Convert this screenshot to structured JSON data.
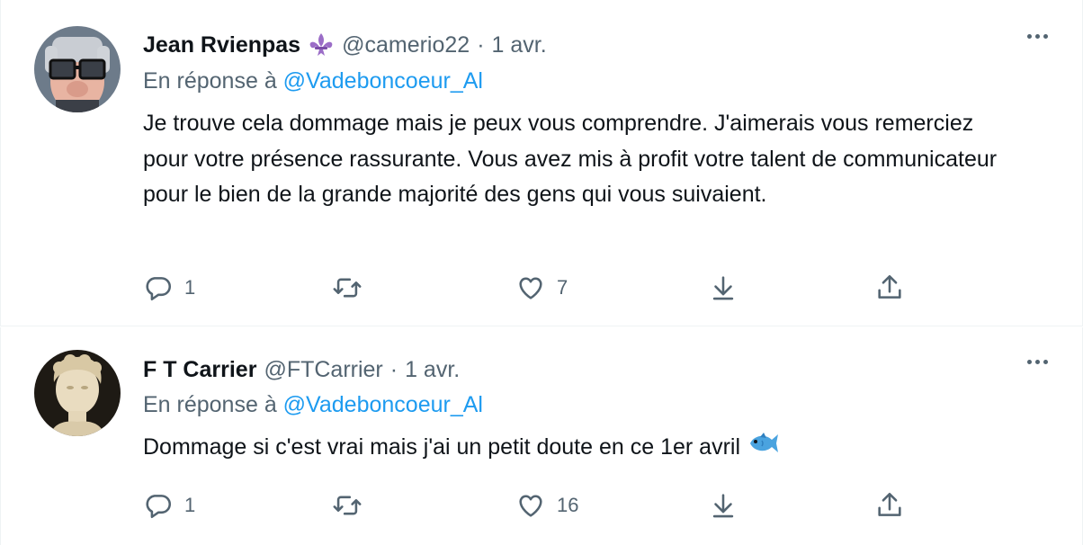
{
  "tweets": [
    {
      "name": "Jean Rvienpas",
      "name_emoji": "fleur-de-lis-icon",
      "handle": "@camerio22",
      "separator": "·",
      "date": "1 avr.",
      "reply_prefix": "En réponse à",
      "reply_mention": "@Vadeboncoeur_Al",
      "text": "Je trouve cela dommage mais je peux vous comprendre. J'aimerais vous remerciez pour votre présence rassurante.  Vous avez mis à profit votre talent de communicateur pour le bien de la grande majorité des gens qui vous suivaient.",
      "reply_count": "1",
      "retweet_count": "",
      "like_count": "7"
    },
    {
      "name": "F T Carrier",
      "handle": "@FTCarrier",
      "separator": "·",
      "date": "1 avr.",
      "reply_prefix": "En réponse à",
      "reply_mention": "@Vadeboncoeur_Al",
      "text": "Dommage si c'est vrai mais j'ai un petit doute en ce 1er avril",
      "text_emoji": "fish-icon",
      "reply_count": "1",
      "retweet_count": "",
      "like_count": "16"
    }
  ],
  "colors": {
    "text": "#0f1419",
    "secondary": "#536471",
    "accent": "#1d9bf0",
    "divider": "#eff3f4"
  }
}
